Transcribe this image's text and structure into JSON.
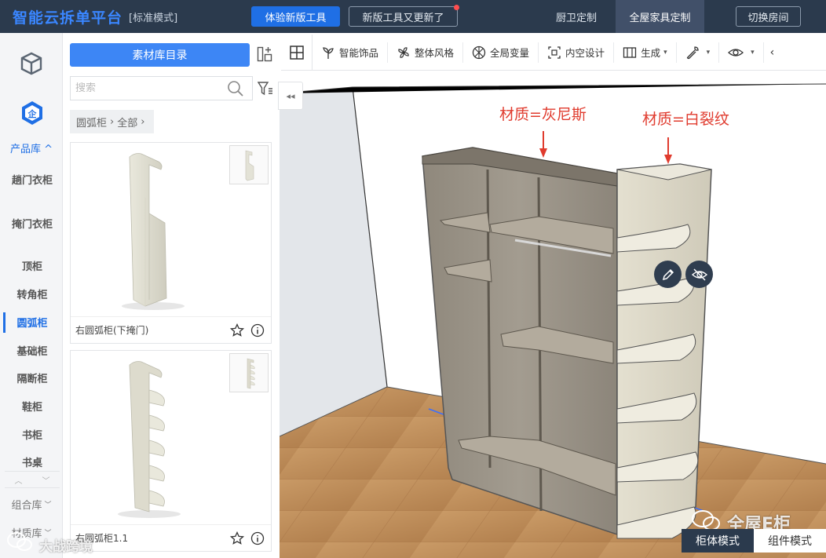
{
  "header": {
    "app_title": "智能云拆单平台",
    "mode": "[标准模式]",
    "try_new_tools": "体验新版工具",
    "new_tools_updated": "新版工具又更新了",
    "tabs": [
      {
        "label": "厨卫定制",
        "active": false
      },
      {
        "label": "全屋家具定制",
        "active": true
      }
    ],
    "switch_room": "切换房间"
  },
  "left_nav": {
    "product_library": "产品库 ^",
    "categories": [
      {
        "label": "趟门衣柜",
        "active": false
      },
      {
        "label": "掩门衣柜",
        "active": false
      },
      {
        "label": "顶柜",
        "active": false
      },
      {
        "label": "转角柜",
        "active": false
      },
      {
        "label": "圆弧柜",
        "active": true
      },
      {
        "label": "基础柜",
        "active": false
      },
      {
        "label": "隔断柜",
        "active": false
      },
      {
        "label": "鞋柜",
        "active": false
      },
      {
        "label": "书柜",
        "active": false
      },
      {
        "label": "书桌",
        "active": false
      }
    ],
    "combo_library": "组合库",
    "material_library": "材质库"
  },
  "catalog": {
    "button_label": "素材库目录",
    "search_placeholder": "搜索",
    "breadcrumb": [
      "圆弧柜",
      "全部"
    ],
    "items": [
      {
        "name": "右圆弧柜(下掩门)"
      },
      {
        "name": "右圆弧柜1.1"
      }
    ]
  },
  "toolbar": {
    "tools": [
      {
        "label": "智能饰品",
        "icon": "plant-icon"
      },
      {
        "label": "整体风格",
        "icon": "fan-icon"
      },
      {
        "label": "全局变量",
        "icon": "globe-icon"
      },
      {
        "label": "内空设计",
        "icon": "frame-icon"
      },
      {
        "label": "生成",
        "icon": "layout-icon",
        "dropdown": true
      }
    ]
  },
  "viewport": {
    "annotation_left": "材质=灰尼斯",
    "annotation_right": "材质=白裂纹",
    "mode_cabinet": "柜体模式",
    "mode_component": "组件模式",
    "watermark_right": "全屋E柜",
    "watermark_left": "大战跨境"
  },
  "colors": {
    "topbar": "#2b3a4d",
    "accent": "#1f6fe5",
    "annotation": "#e03b2e"
  }
}
